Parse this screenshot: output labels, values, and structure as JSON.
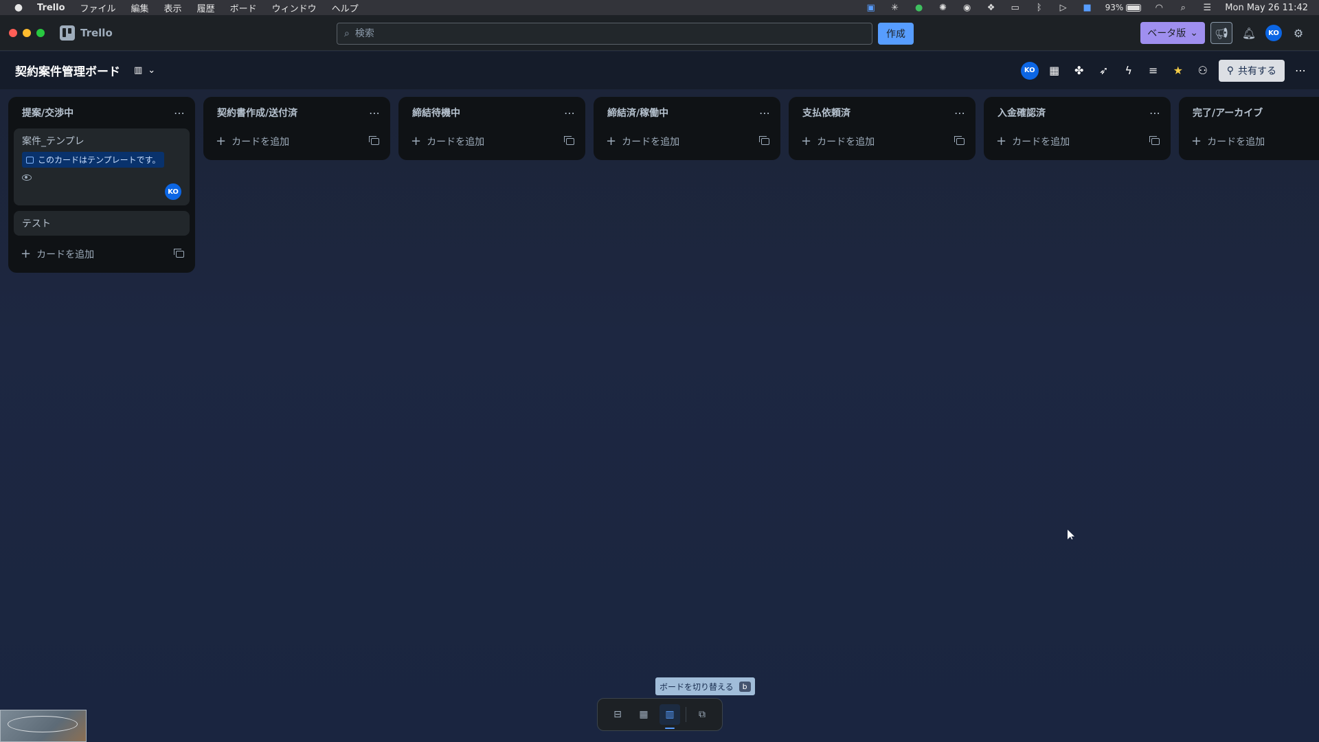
{
  "menubar": {
    "apple": "",
    "items": [
      "Trello",
      "ファイル",
      "編集",
      "表示",
      "履歴",
      "ボード",
      "ウィンドウ",
      "ヘルプ"
    ],
    "battery": "93%",
    "clock": "Mon May 26  11:42"
  },
  "topbar": {
    "app_name": "Trello",
    "search_placeholder": "検索",
    "create_label": "作成",
    "beta_label": "ベータ版",
    "avatar_initials": "KO"
  },
  "board": {
    "title": "契約案件管理ボード",
    "view_icon": "board-icon",
    "member_initials": "KO",
    "share_label": "共有する"
  },
  "lists": [
    {
      "title": "提案/交渉中",
      "add_label": "カードを追加",
      "cards": [
        {
          "title": "案件_テンプレ",
          "badge": "このカードはテンプレートです。",
          "member": "KO"
        },
        {
          "title": "テスト"
        }
      ]
    },
    {
      "title": "契約書作成/送付済",
      "add_label": "カードを追加"
    },
    {
      "title": "締結待機中",
      "add_label": "カードを追加"
    },
    {
      "title": "締結済/稼働中",
      "add_label": "カードを追加"
    },
    {
      "title": "支払依頼済",
      "add_label": "カードを追加"
    },
    {
      "title": "入金確認済",
      "add_label": "カードを追加"
    },
    {
      "title": "完了/アーカイブ",
      "add_label": "カードを追加"
    }
  ],
  "switcher": {
    "tooltip": "ボードを切り替える",
    "shortcut": "b"
  },
  "colors": {
    "accent": "#579dff",
    "beta": "#9f8fef",
    "avatar": "#0c66e4",
    "star": "#f5cd47",
    "template_badge": "#09326c"
  }
}
